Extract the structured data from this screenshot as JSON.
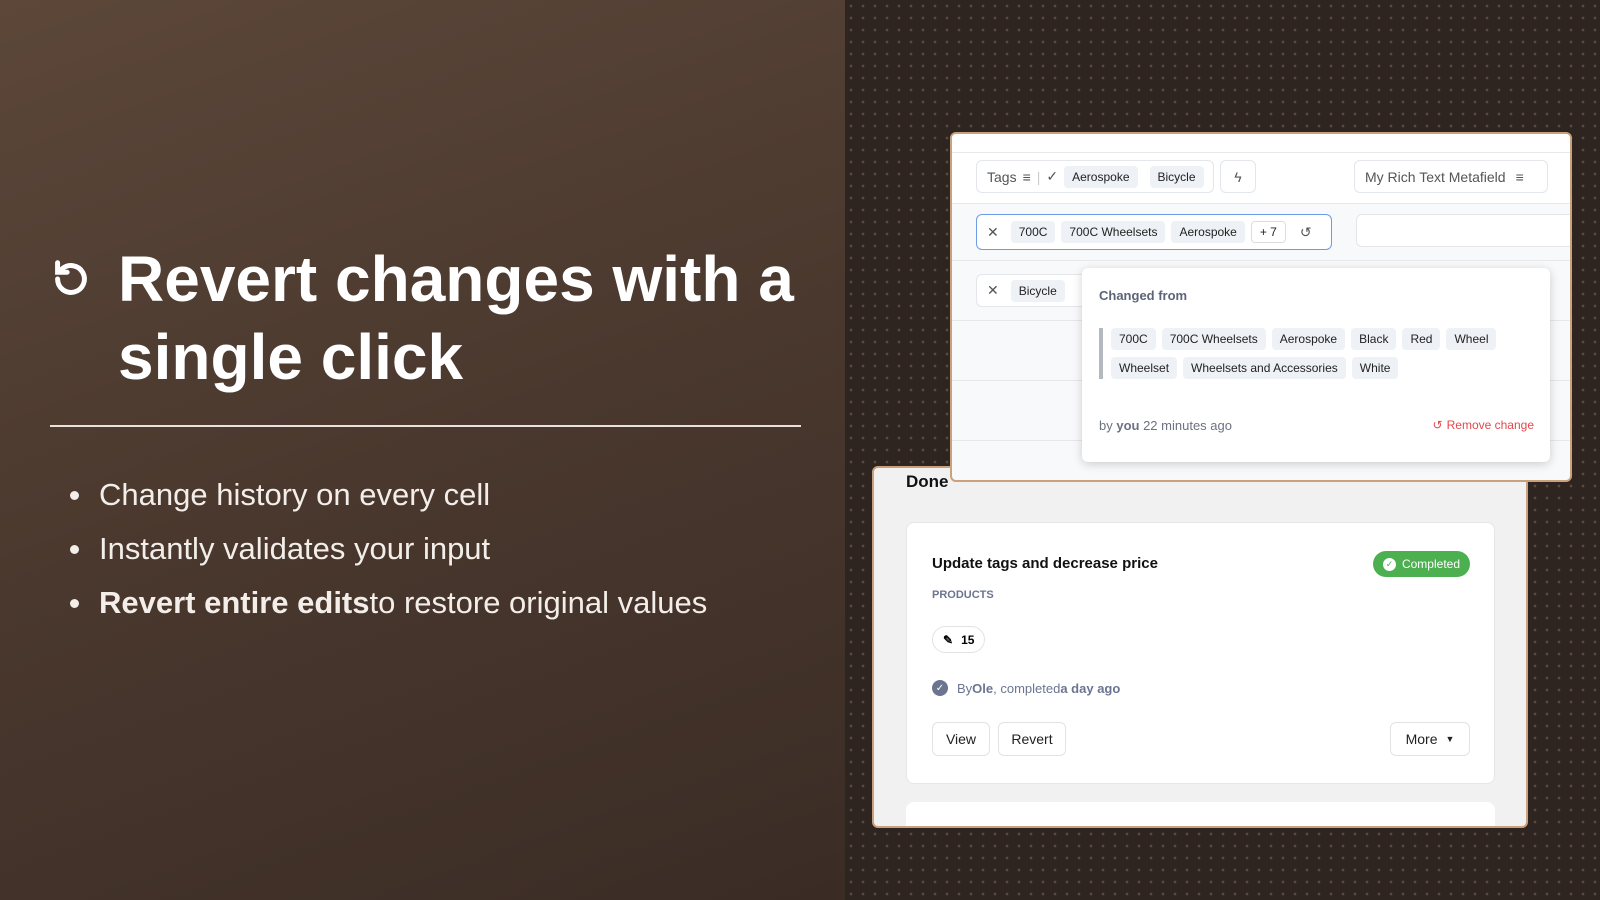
{
  "hero": {
    "title": "Revert changes with a single click",
    "bullets": [
      {
        "bold": "",
        "text": "Change history on every cell"
      },
      {
        "bold": "",
        "text": "Instantly validates your input"
      },
      {
        "bold": "Revert entire edits",
        "text": " to restore original values"
      }
    ]
  },
  "grid": {
    "tags_header": "Tags",
    "filter_chips": [
      "Aerospoke",
      "Bicycle"
    ],
    "rich_header": "My Rich Text Metafield",
    "row1_chips": [
      "700C",
      "700C Wheelsets",
      "Aerospoke"
    ],
    "row1_more": "+ 7",
    "row2_chips": [
      "Bicycle"
    ]
  },
  "popover": {
    "title": "Changed from",
    "chips": [
      "700C",
      "700C Wheelsets",
      "Aerospoke",
      "Black",
      "Red",
      "Wheel",
      "Wheelset",
      "Wheelsets and Accessories",
      "White"
    ],
    "by": "by ",
    "user": "you",
    "time": " 22 minutes ago",
    "remove": "Remove change"
  },
  "done": {
    "heading": "Done",
    "card_title": "Update tags and decrease price",
    "status": "Completed",
    "category": "PRODUCTS",
    "edits": "15",
    "by": "By ",
    "user": "Ole",
    "mid": ", completed ",
    "when": "a day ago",
    "view": "View",
    "revert": "Revert",
    "more": "More"
  },
  "colors": {
    "success": "#4caf50",
    "danger": "#e5484d",
    "border": "#c9a27d"
  }
}
